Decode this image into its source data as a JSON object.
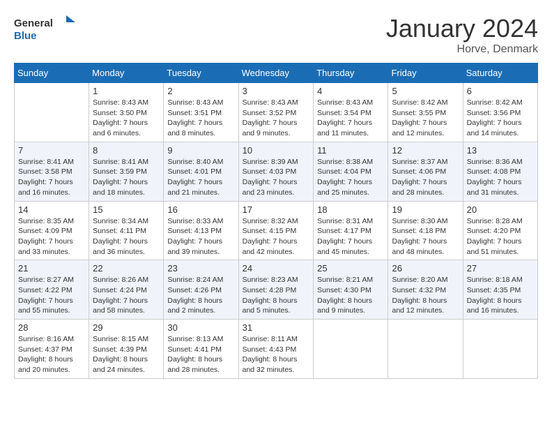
{
  "header": {
    "logo_general": "General",
    "logo_blue": "Blue",
    "month": "January 2024",
    "location": "Horve, Denmark"
  },
  "weekdays": [
    "Sunday",
    "Monday",
    "Tuesday",
    "Wednesday",
    "Thursday",
    "Friday",
    "Saturday"
  ],
  "weeks": [
    [
      {
        "day": "",
        "sunrise": "",
        "sunset": "",
        "daylight": ""
      },
      {
        "day": "1",
        "sunrise": "Sunrise: 8:43 AM",
        "sunset": "Sunset: 3:50 PM",
        "daylight": "Daylight: 7 hours and 6 minutes."
      },
      {
        "day": "2",
        "sunrise": "Sunrise: 8:43 AM",
        "sunset": "Sunset: 3:51 PM",
        "daylight": "Daylight: 7 hours and 8 minutes."
      },
      {
        "day": "3",
        "sunrise": "Sunrise: 8:43 AM",
        "sunset": "Sunset: 3:52 PM",
        "daylight": "Daylight: 7 hours and 9 minutes."
      },
      {
        "day": "4",
        "sunrise": "Sunrise: 8:43 AM",
        "sunset": "Sunset: 3:54 PM",
        "daylight": "Daylight: 7 hours and 11 minutes."
      },
      {
        "day": "5",
        "sunrise": "Sunrise: 8:42 AM",
        "sunset": "Sunset: 3:55 PM",
        "daylight": "Daylight: 7 hours and 12 minutes."
      },
      {
        "day": "6",
        "sunrise": "Sunrise: 8:42 AM",
        "sunset": "Sunset: 3:56 PM",
        "daylight": "Daylight: 7 hours and 14 minutes."
      }
    ],
    [
      {
        "day": "7",
        "sunrise": "Sunrise: 8:41 AM",
        "sunset": "Sunset: 3:58 PM",
        "daylight": "Daylight: 7 hours and 16 minutes."
      },
      {
        "day": "8",
        "sunrise": "Sunrise: 8:41 AM",
        "sunset": "Sunset: 3:59 PM",
        "daylight": "Daylight: 7 hours and 18 minutes."
      },
      {
        "day": "9",
        "sunrise": "Sunrise: 8:40 AM",
        "sunset": "Sunset: 4:01 PM",
        "daylight": "Daylight: 7 hours and 21 minutes."
      },
      {
        "day": "10",
        "sunrise": "Sunrise: 8:39 AM",
        "sunset": "Sunset: 4:03 PM",
        "daylight": "Daylight: 7 hours and 23 minutes."
      },
      {
        "day": "11",
        "sunrise": "Sunrise: 8:38 AM",
        "sunset": "Sunset: 4:04 PM",
        "daylight": "Daylight: 7 hours and 25 minutes."
      },
      {
        "day": "12",
        "sunrise": "Sunrise: 8:37 AM",
        "sunset": "Sunset: 4:06 PM",
        "daylight": "Daylight: 7 hours and 28 minutes."
      },
      {
        "day": "13",
        "sunrise": "Sunrise: 8:36 AM",
        "sunset": "Sunset: 4:08 PM",
        "daylight": "Daylight: 7 hours and 31 minutes."
      }
    ],
    [
      {
        "day": "14",
        "sunrise": "Sunrise: 8:35 AM",
        "sunset": "Sunset: 4:09 PM",
        "daylight": "Daylight: 7 hours and 33 minutes."
      },
      {
        "day": "15",
        "sunrise": "Sunrise: 8:34 AM",
        "sunset": "Sunset: 4:11 PM",
        "daylight": "Daylight: 7 hours and 36 minutes."
      },
      {
        "day": "16",
        "sunrise": "Sunrise: 8:33 AM",
        "sunset": "Sunset: 4:13 PM",
        "daylight": "Daylight: 7 hours and 39 minutes."
      },
      {
        "day": "17",
        "sunrise": "Sunrise: 8:32 AM",
        "sunset": "Sunset: 4:15 PM",
        "daylight": "Daylight: 7 hours and 42 minutes."
      },
      {
        "day": "18",
        "sunrise": "Sunrise: 8:31 AM",
        "sunset": "Sunset: 4:17 PM",
        "daylight": "Daylight: 7 hours and 45 minutes."
      },
      {
        "day": "19",
        "sunrise": "Sunrise: 8:30 AM",
        "sunset": "Sunset: 4:18 PM",
        "daylight": "Daylight: 7 hours and 48 minutes."
      },
      {
        "day": "20",
        "sunrise": "Sunrise: 8:28 AM",
        "sunset": "Sunset: 4:20 PM",
        "daylight": "Daylight: 7 hours and 51 minutes."
      }
    ],
    [
      {
        "day": "21",
        "sunrise": "Sunrise: 8:27 AM",
        "sunset": "Sunset: 4:22 PM",
        "daylight": "Daylight: 7 hours and 55 minutes."
      },
      {
        "day": "22",
        "sunrise": "Sunrise: 8:26 AM",
        "sunset": "Sunset: 4:24 PM",
        "daylight": "Daylight: 7 hours and 58 minutes."
      },
      {
        "day": "23",
        "sunrise": "Sunrise: 8:24 AM",
        "sunset": "Sunset: 4:26 PM",
        "daylight": "Daylight: 8 hours and 2 minutes."
      },
      {
        "day": "24",
        "sunrise": "Sunrise: 8:23 AM",
        "sunset": "Sunset: 4:28 PM",
        "daylight": "Daylight: 8 hours and 5 minutes."
      },
      {
        "day": "25",
        "sunrise": "Sunrise: 8:21 AM",
        "sunset": "Sunset: 4:30 PM",
        "daylight": "Daylight: 8 hours and 9 minutes."
      },
      {
        "day": "26",
        "sunrise": "Sunrise: 8:20 AM",
        "sunset": "Sunset: 4:32 PM",
        "daylight": "Daylight: 8 hours and 12 minutes."
      },
      {
        "day": "27",
        "sunrise": "Sunrise: 8:18 AM",
        "sunset": "Sunset: 4:35 PM",
        "daylight": "Daylight: 8 hours and 16 minutes."
      }
    ],
    [
      {
        "day": "28",
        "sunrise": "Sunrise: 8:16 AM",
        "sunset": "Sunset: 4:37 PM",
        "daylight": "Daylight: 8 hours and 20 minutes."
      },
      {
        "day": "29",
        "sunrise": "Sunrise: 8:15 AM",
        "sunset": "Sunset: 4:39 PM",
        "daylight": "Daylight: 8 hours and 24 minutes."
      },
      {
        "day": "30",
        "sunrise": "Sunrise: 8:13 AM",
        "sunset": "Sunset: 4:41 PM",
        "daylight": "Daylight: 8 hours and 28 minutes."
      },
      {
        "day": "31",
        "sunrise": "Sunrise: 8:11 AM",
        "sunset": "Sunset: 4:43 PM",
        "daylight": "Daylight: 8 hours and 32 minutes."
      },
      {
        "day": "",
        "sunrise": "",
        "sunset": "",
        "daylight": ""
      },
      {
        "day": "",
        "sunrise": "",
        "sunset": "",
        "daylight": ""
      },
      {
        "day": "",
        "sunrise": "",
        "sunset": "",
        "daylight": ""
      }
    ]
  ]
}
